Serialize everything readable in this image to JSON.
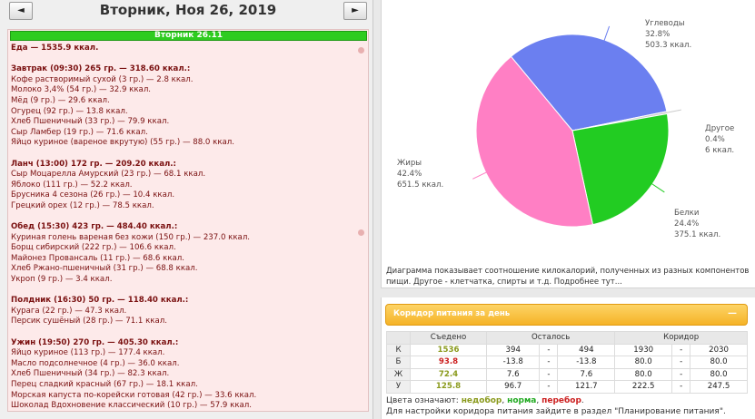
{
  "header": {
    "date_title": "Вторник, Ноя 26, 2019",
    "prev_label": "◄",
    "next_label": "►"
  },
  "day": {
    "bar_label": "Вторник 26.11",
    "lines": [
      {
        "text": "Еда — 1535.9 ккал.",
        "bold": true
      },
      {
        "text": "",
        "bold": false
      },
      {
        "text": "Завтрак (09:30) 265 гр. — 318.60 ккал.:",
        "bold": true
      },
      {
        "text": "Кофе растворимый сухой (3 гр.) — 2.8 ккал.",
        "bold": false
      },
      {
        "text": "Молоко 3,4% (54 гр.) — 32.9 ккал.",
        "bold": false
      },
      {
        "text": "Мёд (9 гр.) — 29.6 ккал.",
        "bold": false
      },
      {
        "text": "Огурец (92 гр.) — 13.8 ккал.",
        "bold": false
      },
      {
        "text": "Хлеб Пшеничный (33 гр.) — 79.9 ккал.",
        "bold": false
      },
      {
        "text": "Сыр Ламбер (19 гр.) — 71.6 ккал.",
        "bold": false
      },
      {
        "text": "Яйцо куриное (вареное вкрутую) (55 гр.) — 88.0 ккал.",
        "bold": false
      },
      {
        "text": "",
        "bold": false
      },
      {
        "text": "Ланч (13:00) 172 гр. — 209.20 ккал.:",
        "bold": true
      },
      {
        "text": "Сыр Моцарелла Амурский (23 гр.) — 68.1 ккал.",
        "bold": false
      },
      {
        "text": "Яблоко (111 гр.) — 52.2 ккал.",
        "bold": false
      },
      {
        "text": "Брусника 4 сезона (26 гр.) — 10.4 ккал.",
        "bold": false
      },
      {
        "text": "Грецкий орех (12 гр.) — 78.5 ккал.",
        "bold": false
      },
      {
        "text": "",
        "bold": false
      },
      {
        "text": "Обед (15:30) 423 гр. — 484.40 ккал.:",
        "bold": true
      },
      {
        "text": "Куриная голень вареная без кожи (150 гр.) — 237.0 ккал.",
        "bold": false
      },
      {
        "text": "Борщ сибирский (222 гр.) — 106.6 ккал.",
        "bold": false
      },
      {
        "text": "Майонез Провансаль (11 гр.) — 68.6 ккал.",
        "bold": false
      },
      {
        "text": "Хлеб Ржано-пшеничный (31 гр.) — 68.8 ккал.",
        "bold": false
      },
      {
        "text": "Укроп (9 гр.) — 3.4 ккал.",
        "bold": false
      },
      {
        "text": "",
        "bold": false
      },
      {
        "text": "Полдник (16:30) 50 гр. — 118.40 ккал.:",
        "bold": true
      },
      {
        "text": "Курага (22 гр.) — 47.3 ккал.",
        "bold": false
      },
      {
        "text": "Персик сушёный (28 гр.) — 71.1 ккал.",
        "bold": false
      },
      {
        "text": "",
        "bold": false
      },
      {
        "text": "Ужин (19:50) 270 гр. — 405.30 ккал.:",
        "bold": true
      },
      {
        "text": "Яйцо куриное (113 гр.) — 177.4 ккал.",
        "bold": false
      },
      {
        "text": "Масло подсолнечное (4 гр.) — 36.0 ккал.",
        "bold": false
      },
      {
        "text": "Хлеб Пшеничный (34 гр.) — 82.3 ккал.",
        "bold": false
      },
      {
        "text": "Перец сладкий красный (67 гр.) — 18.1 ккал.",
        "bold": false
      },
      {
        "text": "Морская капуста по-корейски готовая (42 гр.) — 33.6 ккал.",
        "bold": false
      },
      {
        "text": "Шоколад Вдохновение классический (10 гр.) — 57.9 ккал.",
        "bold": false
      }
    ]
  },
  "chart_data": {
    "type": "pie",
    "slices": [
      {
        "name": "Углеводы",
        "percent": 32.8,
        "value": 503.3,
        "unit": "ккал.",
        "color": "#6b7ff0"
      },
      {
        "name": "Другое",
        "percent": 0.4,
        "value": 6,
        "unit": "ккал.",
        "color": "#cccccc"
      },
      {
        "name": "Белки",
        "percent": 24.4,
        "value": 375.1,
        "unit": "ккал.",
        "color": "#22cc22"
      },
      {
        "name": "Жиры",
        "percent": 42.4,
        "value": 651.5,
        "unit": "ккал.",
        "color": "#ff7fc4"
      }
    ],
    "labels": [
      {
        "name": "Углеводы",
        "pct": "32.8%",
        "kcal": "503.3 ккал."
      },
      {
        "name": "Другое",
        "pct": "0.4%",
        "kcal": "6 ккал."
      },
      {
        "name": "Белки",
        "pct": "24.4%",
        "kcal": "375.1 ккал."
      },
      {
        "name": "Жиры",
        "pct": "42.4%",
        "kcal": "651.5 ккал."
      }
    ]
  },
  "chart_caption": "Диаграмма показывает соотношение килокалорий, полученных из разных компонентов пищи. Другое - клетчатка, спирты и т.д. Подробнее тут...",
  "corridor": {
    "title": "Коридор питания за день",
    "collapse_label": "—",
    "headers": {
      "eaten": "Съедено",
      "left": "Осталось",
      "corridor": "Коридор"
    },
    "rows": [
      {
        "label": "К",
        "eaten": "1536",
        "color": "#8a9a1c",
        "left_min": "394",
        "left_max": "494",
        "cor_min": "1930",
        "cor_max": "2030"
      },
      {
        "label": "Б",
        "eaten": "93.8",
        "color": "#cc2020",
        "left_min": "-13.8",
        "left_max": "-13.8",
        "cor_min": "80.0",
        "cor_max": "80.0"
      },
      {
        "label": "Ж",
        "eaten": "72.4",
        "color": "#8a9a1c",
        "left_min": "7.6",
        "left_max": "7.6",
        "cor_min": "80.0",
        "cor_max": "80.0"
      },
      {
        "label": "У",
        "eaten": "125.8",
        "color": "#8a9a1c",
        "left_min": "96.7",
        "left_max": "121.7",
        "cor_min": "222.5",
        "cor_max": "247.5"
      }
    ],
    "dash": "-",
    "legend_prefix": "Цвета означают: ",
    "legend_under": "недобор",
    "legend_norm": "норма",
    "legend_over": "перебор",
    "legend_sep": ", ",
    "legend_end": ".",
    "colors": {
      "under": "#8a9a1c",
      "norm": "#22aa22",
      "over": "#cc2020"
    },
    "settings_text": "Для настройки коридора питания зайдите в раздел \"Планирование питания\"."
  }
}
